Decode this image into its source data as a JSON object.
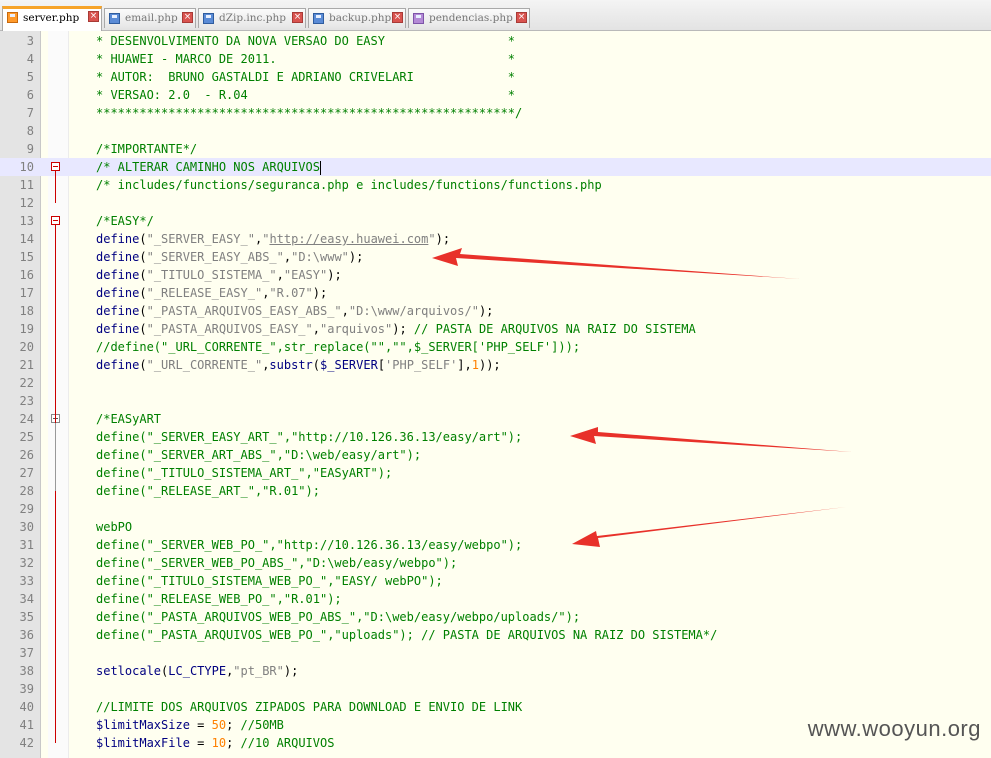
{
  "tabs": [
    {
      "label": "server.php",
      "active": true
    },
    {
      "label": "email.php",
      "active": false
    },
    {
      "label": "dZip.inc.php",
      "active": false
    },
    {
      "label": "backup.php",
      "active": false
    },
    {
      "label": "pendencias.php",
      "active": false
    }
  ],
  "editor": {
    "current_line": 10,
    "lines": [
      {
        "n": "3",
        "tokens": [
          [
            "cmt",
            "* DESENVOLVIMENTO DA NOVA VERSAO DO EASY                 *"
          ]
        ]
      },
      {
        "n": "4",
        "tokens": [
          [
            "cmt",
            "* HUAWEI - MARCO DE 2011.                                *"
          ]
        ]
      },
      {
        "n": "5",
        "tokens": [
          [
            "cmt",
            "* AUTOR:  BRUNO GASTALDI E ADRIANO CRIVELARI             *"
          ]
        ]
      },
      {
        "n": "6",
        "tokens": [
          [
            "cmt",
            "* VERSAO: 2.0  - R.04                                    *"
          ]
        ]
      },
      {
        "n": "7",
        "tokens": [
          [
            "cmt",
            "**********************************************************/"
          ]
        ]
      },
      {
        "n": "8",
        "tokens": []
      },
      {
        "n": "9",
        "tokens": [
          [
            "cmt",
            "/*IMPORTANTE*/"
          ]
        ]
      },
      {
        "n": "10",
        "tokens": [
          [
            "cmt",
            "/* ALTERAR CAMINHO NOS ARQUIVOS"
          ]
        ]
      },
      {
        "n": "11",
        "tokens": [
          [
            "cmt",
            "/* includes/functions/seguranca.php e includes/functions/functions.php"
          ]
        ]
      },
      {
        "n": "12",
        "tokens": []
      },
      {
        "n": "13",
        "tokens": [
          [
            "cmt",
            "/*EASY*/"
          ]
        ]
      },
      {
        "n": "14",
        "tokens": [
          [
            "kw",
            "define"
          ],
          [
            "plain",
            "("
          ],
          [
            "str",
            "\"_SERVER_EASY_\""
          ],
          [
            "plain",
            ","
          ],
          [
            "str",
            "\""
          ],
          [
            "link",
            "http://easy.huawei.com"
          ],
          [
            "str",
            "\""
          ],
          [
            "plain",
            ");"
          ]
        ]
      },
      {
        "n": "15",
        "tokens": [
          [
            "kw",
            "define"
          ],
          [
            "plain",
            "("
          ],
          [
            "str",
            "\"_SERVER_EASY_ABS_\""
          ],
          [
            "plain",
            ","
          ],
          [
            "str",
            "\"D:\\www\""
          ],
          [
            "plain",
            ");"
          ]
        ]
      },
      {
        "n": "16",
        "tokens": [
          [
            "kw",
            "define"
          ],
          [
            "plain",
            "("
          ],
          [
            "str",
            "\"_TITULO_SISTEMA_\""
          ],
          [
            "plain",
            ","
          ],
          [
            "str",
            "\"EASY\""
          ],
          [
            "plain",
            ");"
          ]
        ]
      },
      {
        "n": "17",
        "tokens": [
          [
            "kw",
            "define"
          ],
          [
            "plain",
            "("
          ],
          [
            "str",
            "\"_RELEASE_EASY_\""
          ],
          [
            "plain",
            ","
          ],
          [
            "str",
            "\"R.07\""
          ],
          [
            "plain",
            ");"
          ]
        ]
      },
      {
        "n": "18",
        "tokens": [
          [
            "kw",
            "define"
          ],
          [
            "plain",
            "("
          ],
          [
            "str",
            "\"_PASTA_ARQUIVOS_EASY_ABS_\""
          ],
          [
            "plain",
            ","
          ],
          [
            "str",
            "\"D:\\www/arquivos/\""
          ],
          [
            "plain",
            ");"
          ]
        ]
      },
      {
        "n": "19",
        "tokens": [
          [
            "kw",
            "define"
          ],
          [
            "plain",
            "("
          ],
          [
            "str",
            "\"_PASTA_ARQUIVOS_EASY_\""
          ],
          [
            "plain",
            ","
          ],
          [
            "str",
            "\"arquivos\""
          ],
          [
            "plain",
            ");"
          ],
          [
            "cmt",
            " // PASTA DE ARQUIVOS NA RAIZ DO SISTEMA"
          ]
        ]
      },
      {
        "n": "20",
        "tokens": [
          [
            "cmt",
            "//define(\"_URL_CORRENTE_\",str_replace(\"\",\"\",$_SERVER['PHP_SELF']));"
          ]
        ]
      },
      {
        "n": "21",
        "tokens": [
          [
            "kw",
            "define"
          ],
          [
            "plain",
            "("
          ],
          [
            "str",
            "\"_URL_CORRENTE_\""
          ],
          [
            "plain",
            ","
          ],
          [
            "kw",
            "substr"
          ],
          [
            "plain",
            "("
          ],
          [
            "var",
            "$_SERVER"
          ],
          [
            "plain",
            "["
          ],
          [
            "str",
            "'PHP_SELF'"
          ],
          [
            "plain",
            "],"
          ],
          [
            "num",
            "1"
          ],
          [
            "plain",
            "));"
          ]
        ]
      },
      {
        "n": "22",
        "tokens": []
      },
      {
        "n": "23",
        "tokens": []
      },
      {
        "n": "24",
        "tokens": [
          [
            "cmt",
            "/*EASyART"
          ]
        ]
      },
      {
        "n": "25",
        "tokens": [
          [
            "cmt",
            "define(\"_SERVER_EASY_ART_\",\"http://10.126.36.13/easy/art\");"
          ]
        ]
      },
      {
        "n": "26",
        "tokens": [
          [
            "cmt",
            "define(\"_SERVER_ART_ABS_\",\"D:\\web/easy/art\");"
          ]
        ]
      },
      {
        "n": "27",
        "tokens": [
          [
            "cmt",
            "define(\"_TITULO_SISTEMA_ART_\",\"EASyART\");"
          ]
        ]
      },
      {
        "n": "28",
        "tokens": [
          [
            "cmt",
            "define(\"_RELEASE_ART_\",\"R.01\");"
          ]
        ]
      },
      {
        "n": "29",
        "tokens": []
      },
      {
        "n": "30",
        "tokens": [
          [
            "cmt",
            "webPO"
          ]
        ]
      },
      {
        "n": "31",
        "tokens": [
          [
            "cmt",
            "define(\"_SERVER_WEB_PO_\",\"http://10.126.36.13/easy/webpo\");"
          ]
        ]
      },
      {
        "n": "32",
        "tokens": [
          [
            "cmt",
            "define(\"_SERVER_WEB_PO_ABS_\",\"D:\\web/easy/webpo\");"
          ]
        ]
      },
      {
        "n": "33",
        "tokens": [
          [
            "cmt",
            "define(\"_TITULO_SISTEMA_WEB_PO_\",\"EASY/ webPO\");"
          ]
        ]
      },
      {
        "n": "34",
        "tokens": [
          [
            "cmt",
            "define(\"_RELEASE_WEB_PO_\",\"R.01\");"
          ]
        ]
      },
      {
        "n": "35",
        "tokens": [
          [
            "cmt",
            "define(\"_PASTA_ARQUIVOS_WEB_PO_ABS_\",\"D:\\web/easy/webpo/uploads/\");"
          ]
        ]
      },
      {
        "n": "36",
        "tokens": [
          [
            "cmt",
            "define(\"_PASTA_ARQUIVOS_WEB_PO_\",\"uploads\"); // PASTA DE ARQUIVOS NA RAIZ DO SISTEMA*/"
          ]
        ]
      },
      {
        "n": "37",
        "tokens": []
      },
      {
        "n": "38",
        "tokens": [
          [
            "kw",
            "setlocale"
          ],
          [
            "plain",
            "("
          ],
          [
            "kw",
            "LC_CTYPE"
          ],
          [
            "plain",
            ","
          ],
          [
            "str",
            "\"pt_BR\""
          ],
          [
            "plain",
            ");"
          ]
        ]
      },
      {
        "n": "39",
        "tokens": []
      },
      {
        "n": "40",
        "tokens": [
          [
            "cmt",
            "//LIMITE DOS ARQUIVOS ZIPADOS PARA DOWNLOAD E ENVIO DE LINK"
          ]
        ]
      },
      {
        "n": "41",
        "tokens": [
          [
            "var",
            "$limitMaxSize"
          ],
          [
            "plain",
            " = "
          ],
          [
            "num",
            "50"
          ],
          [
            "plain",
            "; "
          ],
          [
            "cmt",
            "//50MB"
          ]
        ]
      },
      {
        "n": "42",
        "tokens": [
          [
            "var",
            "$limitMaxFile"
          ],
          [
            "plain",
            " = "
          ],
          [
            "num",
            "10"
          ],
          [
            "plain",
            "; "
          ],
          [
            "cmt",
            "//10 ARQUIVOS"
          ]
        ]
      }
    ]
  },
  "watermark": "www.wooyun.org",
  "colors": {
    "comment": "#008000",
    "keyword": "#000080",
    "string": "#808080",
    "number": "#ff8000",
    "arrow": "#e8312a",
    "active_tab_accent": "#f6a328"
  }
}
